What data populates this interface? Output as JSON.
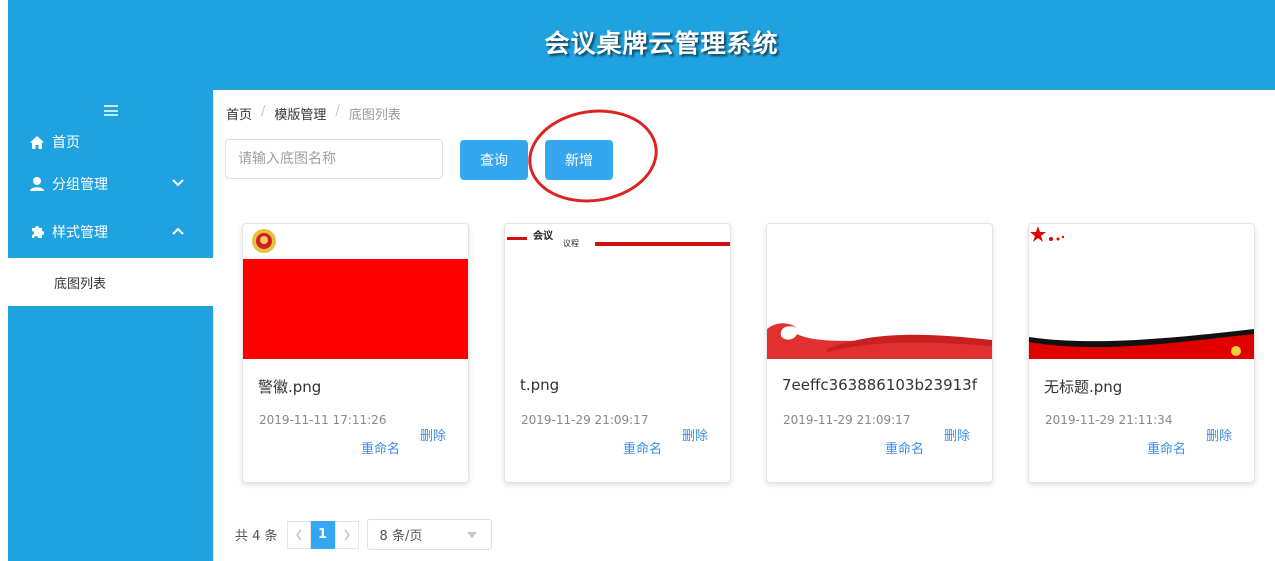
{
  "header": {
    "title": "会议桌牌云管理系统"
  },
  "sidebar": {
    "items": [
      {
        "label": "首页",
        "icon": "home-icon"
      },
      {
        "label": "分组管理",
        "icon": "user-icon",
        "arrow": "chevron-down-icon"
      },
      {
        "label": "样式管理",
        "icon": "puzzle-icon",
        "arrow": "chevron-up-icon"
      }
    ],
    "sub_items": [
      {
        "label": "底图列表"
      }
    ]
  },
  "breadcrumb": [
    "首页",
    "模版管理",
    "底图列表"
  ],
  "search": {
    "placeholder": "请输入底图名称",
    "value": ""
  },
  "buttons": {
    "query": "查询",
    "add": "新增"
  },
  "cards": [
    {
      "name": "警徽.png",
      "date": "2019-11-11 17:11:26",
      "rename": "重命名",
      "delete": "删除"
    },
    {
      "name": "t.png",
      "date": "2019-11-29 21:09:17",
      "rename": "重命名",
      "delete": "删除"
    },
    {
      "name": "7eeffc363886103b23913f",
      "date": "2019-11-29 21:09:17",
      "rename": "重命名",
      "delete": "删除"
    },
    {
      "name": "无标题.png",
      "date": "2019-11-29 21:11:34",
      "rename": "重命名",
      "delete": "删除"
    }
  ],
  "card2_thumb_text": {
    "a": "会议",
    "b": "议程"
  },
  "pagination": {
    "total": "共 4 条",
    "current_page": "1",
    "page_size": "8 条/页"
  },
  "colors": {
    "primary": "#1fa3e0",
    "button": "#34a7f0",
    "link": "#3a8ee6",
    "annotation": "#dd2222"
  }
}
